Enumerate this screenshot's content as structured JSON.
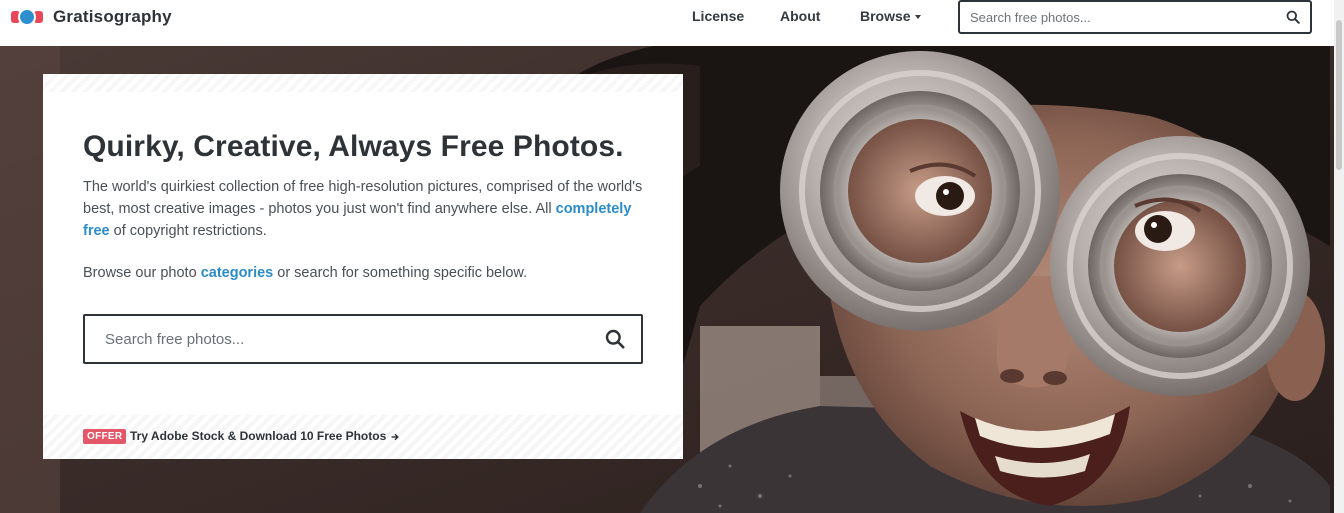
{
  "header": {
    "logo_text": "Gratisography",
    "nav": {
      "license": "License",
      "about": "About",
      "browse": "Browse"
    },
    "search": {
      "placeholder": "Search free photos..."
    }
  },
  "intro": {
    "title": "Quirky, Creative, Always Free Photos.",
    "description_before": "The world's quirkiest collection of free high-resolution pictures, comprised of the world's best, most creative images - photos you just won't find anywhere else. All ",
    "description_link": "completely free",
    "description_after": " of copyright restrictions.",
    "browse_before": "Browse our photo ",
    "browse_link": "categories",
    "browse_after": " or search for something specific below.",
    "search": {
      "placeholder": "Search free photos..."
    },
    "offer": {
      "badge": "OFFER",
      "link_text": "Try Adobe Stock & Download 10 Free Photos"
    }
  },
  "colors": {
    "accent_link": "#2a8cc8",
    "offer_badge": "#e45768",
    "text_dark": "#2e3338"
  },
  "icons": {
    "logo": "gratisography-logo-icon",
    "search": "search-icon",
    "caret": "caret-down-icon",
    "arrow": "arrow-right-icon"
  }
}
